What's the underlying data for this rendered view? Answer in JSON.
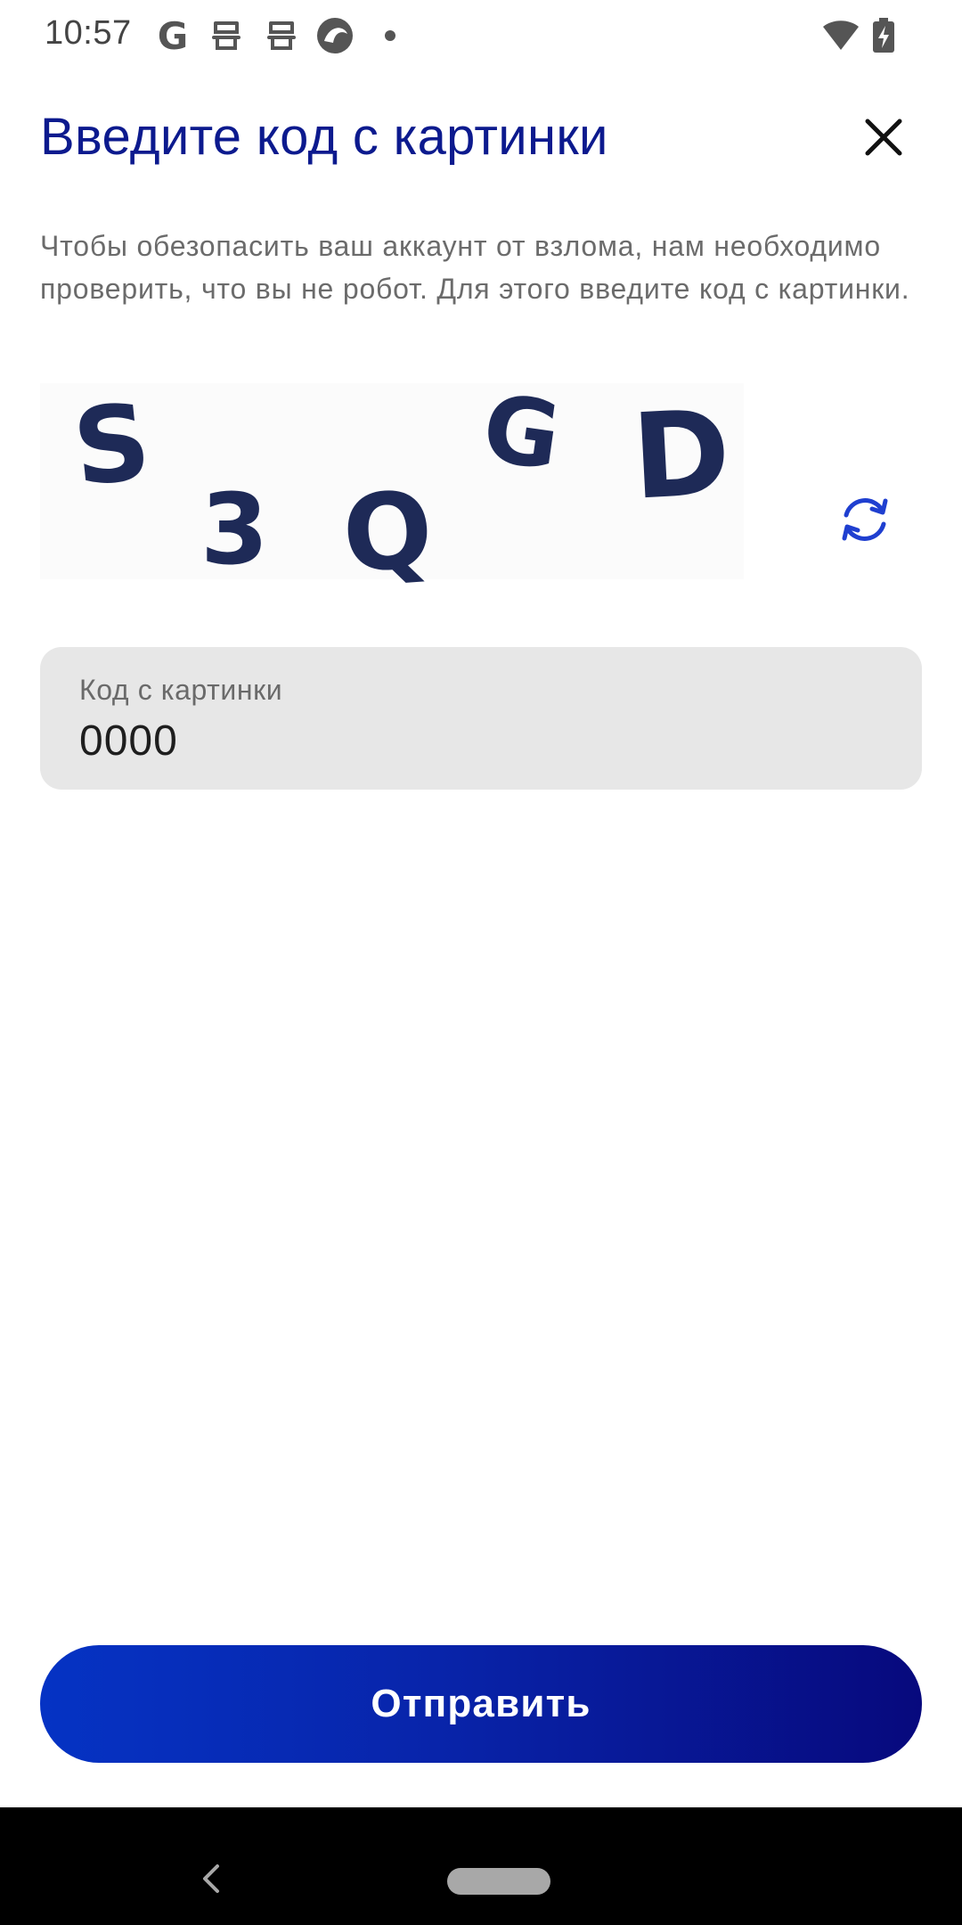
{
  "status_bar": {
    "time": "10:57",
    "icons": [
      "google-g-icon",
      "notification-robot-icon",
      "notification-robot-icon",
      "browser-icon",
      "dot-icon",
      "wifi-icon",
      "battery-charging-icon"
    ]
  },
  "header": {
    "title": "Введите код с картинки",
    "close_icon": "close-icon"
  },
  "description": "Чтобы обезопасить ваш аккаунт от взлома, нам необходимо проверить, что вы не робот. Для этого введите код с картинки.",
  "captcha": {
    "characters": [
      "S",
      "3",
      "Q",
      "G",
      "D"
    ],
    "refresh_icon": "refresh-icon"
  },
  "code_field": {
    "label": "Код с картинки",
    "value": "0000"
  },
  "submit": {
    "label": "Отправить"
  },
  "nav_bar": {
    "icons": [
      "back-icon",
      "home-pill-icon"
    ]
  },
  "colors": {
    "title": "#0c1a8e",
    "button_gradient_start": "#0533c4",
    "button_gradient_end": "#07097d",
    "accent_icon": "#1f3fd0"
  }
}
